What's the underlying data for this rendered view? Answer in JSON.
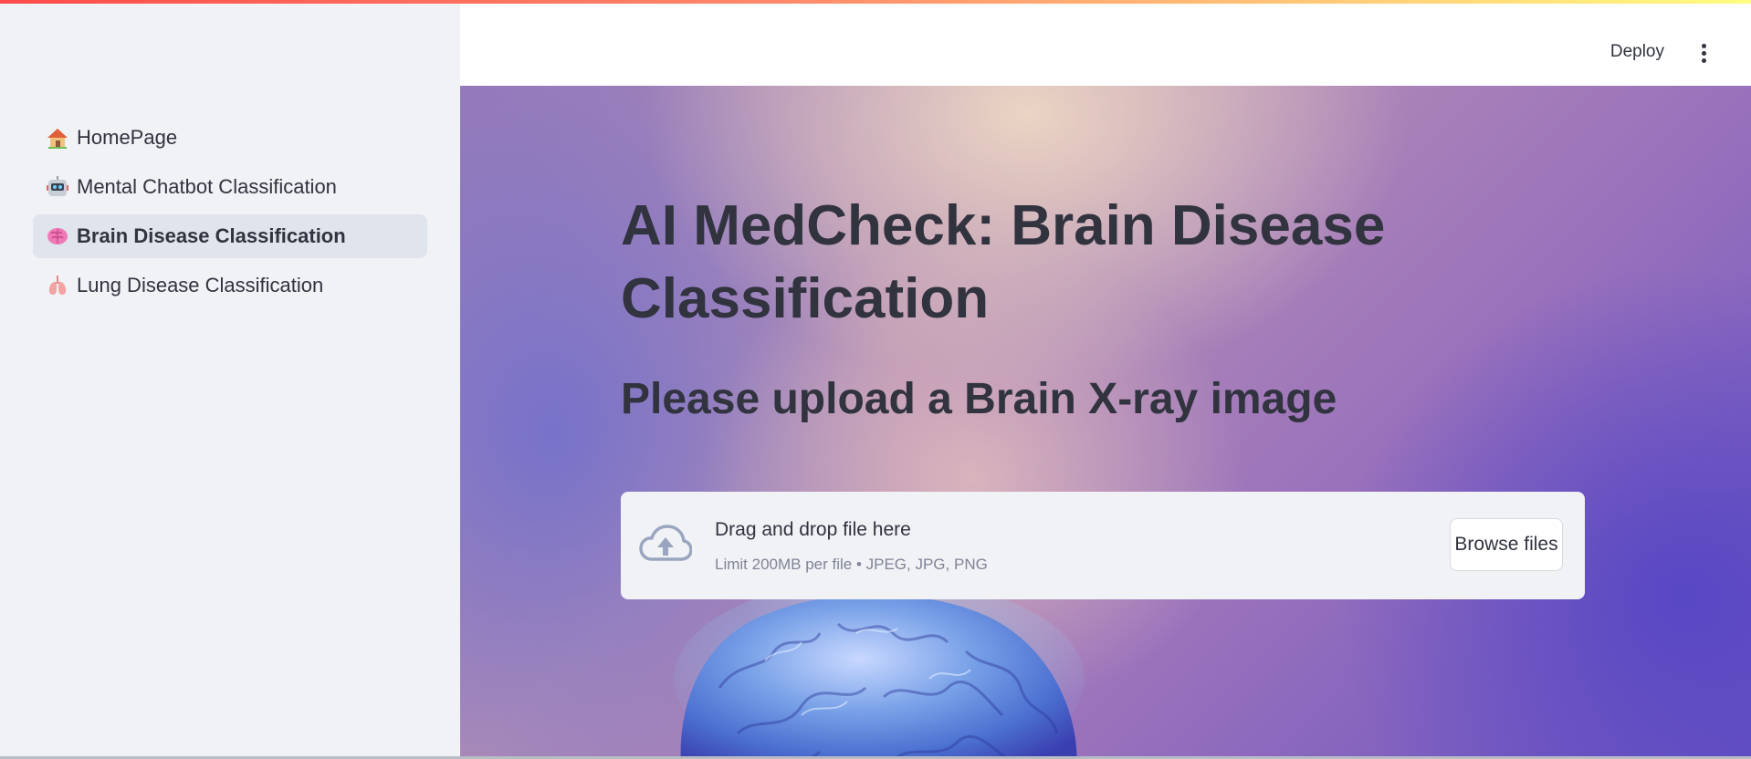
{
  "sidebar": {
    "items": [
      {
        "label": "HomePage",
        "icon": "house-icon",
        "active": false
      },
      {
        "label": "Mental Chatbot Classification",
        "icon": "robot-icon",
        "active": false
      },
      {
        "label": "Brain Disease Classification",
        "icon": "brain-icon",
        "active": true
      },
      {
        "label": "Lung Disease Classification",
        "icon": "lungs-icon",
        "active": false
      }
    ]
  },
  "header": {
    "deploy_label": "Deploy",
    "menu_icon": "kebab-menu-icon"
  },
  "main": {
    "title": "AI MedCheck: Brain Disease Classification",
    "subtitle": "Please upload a Brain X-ray image",
    "uploader": {
      "icon": "cloud-upload-icon",
      "drop_text": "Drag and drop file here",
      "limit_text": "Limit 200MB per file • JPEG, JPG, PNG",
      "browse_label": "Browse files"
    },
    "background_image": "brain-illustration"
  },
  "colors": {
    "text": "#31333f",
    "sidebar_bg": "#f0f2f6",
    "active_item_bg": "#e0e4ec",
    "accent_gradient_start": "#ff4b4b",
    "accent_gradient_end": "#fffd80"
  }
}
